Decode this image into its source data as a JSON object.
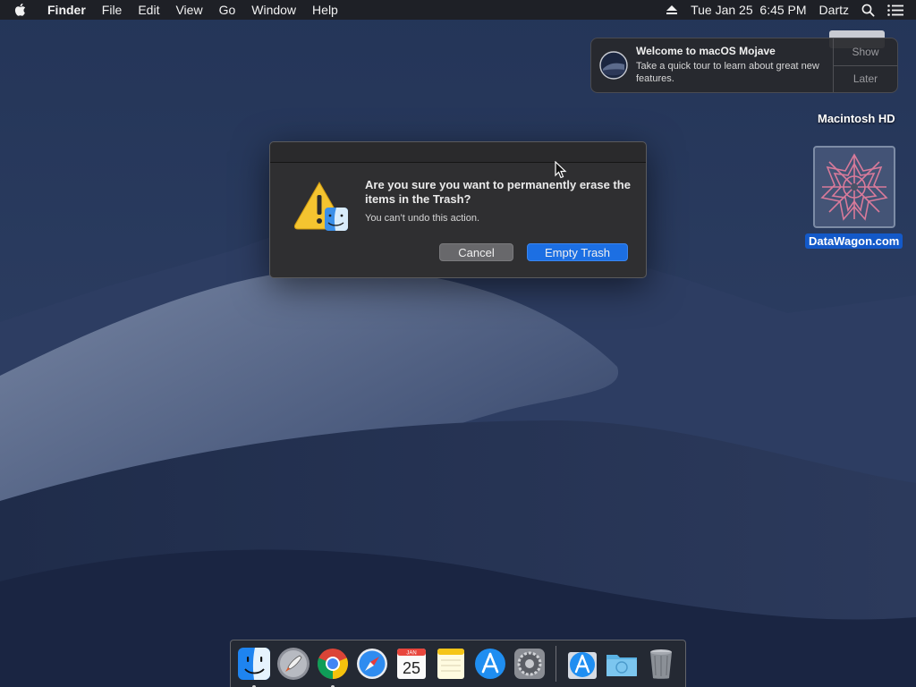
{
  "menubar": {
    "app_name": "Finder",
    "menus": [
      "File",
      "Edit",
      "View",
      "Go",
      "Window",
      "Help"
    ],
    "datetime": "Tue Jan 25  6:45 PM",
    "user": "Dartz"
  },
  "notification": {
    "title": "Welcome to macOS Mojave",
    "text": "Take a quick tour to learn about great new features.",
    "show_label": "Show",
    "later_label": "Later"
  },
  "desktop": {
    "hd_label": "Macintosh HD",
    "file_label": "DataWagon.com"
  },
  "dialog": {
    "heading": "Are you sure you want to permanently erase the items in the Trash?",
    "message": "You can’t undo this action.",
    "cancel_label": "Cancel",
    "confirm_label": "Empty Trash"
  },
  "dock": {
    "calendar_month": "JAN",
    "calendar_day": "25",
    "items": [
      "finder",
      "launchpad",
      "chrome",
      "safari",
      "calendar",
      "notes",
      "app-store",
      "system-preferences",
      "app-store-downloads",
      "downloads-folder",
      "trash"
    ]
  },
  "colors": {
    "accent": "#1c6fe3",
    "selection": "#1359c9"
  }
}
